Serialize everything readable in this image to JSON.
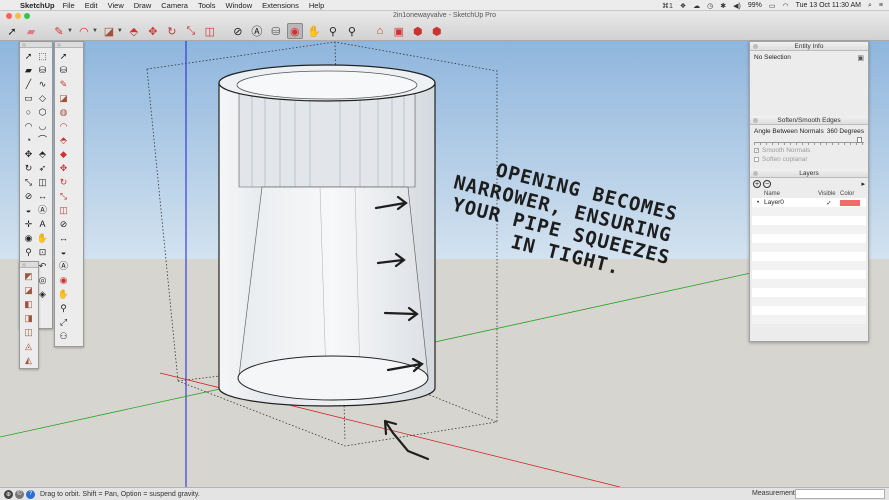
{
  "menubar": {
    "app_name": "SketchUp",
    "items": [
      "File",
      "Edit",
      "View",
      "Draw",
      "Camera",
      "Tools",
      "Window",
      "Extensions",
      "Help"
    ],
    "status_right": {
      "battery": "99%",
      "datetime": "Tue 13 Oct  11:30 AM",
      "input_badge": "1"
    }
  },
  "window": {
    "title": "2in1onewayvalve - SketchUp Pro"
  },
  "toolbar": {
    "tools": [
      "select-arrow-icon",
      "eraser-icon",
      "pencil-line-icon",
      "arc-icon",
      "rectangle-shape-icon",
      "push-pull-icon",
      "move-icon",
      "rotate-icon",
      "scale-icon",
      "offset-icon",
      "tape-measure-icon",
      "text-icon",
      "paint-bucket-icon",
      "orbit-icon",
      "pan-icon",
      "zoom-icon",
      "zoom-extents-icon",
      "warehouse-icon",
      "extension-warehouse-icon",
      "layout-icon",
      "send-icon"
    ],
    "active_tool": "orbit-icon"
  },
  "tray": {
    "entity_info": {
      "title": "Entity Info",
      "selection": "No Selection"
    },
    "soften": {
      "title": "Soften/Smooth Edges",
      "angle_label": "Angle Between Normals",
      "angle_value": "360  Degrees",
      "smooth_normals": "Smooth Normals",
      "soften_coplanar": "Soften coplanar"
    },
    "layers": {
      "title": "Layers",
      "columns": {
        "name": "Name",
        "visible": "Visible",
        "color": "Color"
      },
      "rows": [
        {
          "name": "Layer0",
          "visible": "✓",
          "color": "#f26a6a",
          "active": "•"
        }
      ]
    }
  },
  "annotation": {
    "lines": [
      "OPENING BECOMES",
      "NARROWER, ENSURING",
      "YOUR PIPE SQUEEZES",
      "IN TIGHT."
    ]
  },
  "statusbar": {
    "hint": "Drag to orbit. Shift = Pan, Option = suspend gravity.",
    "measurements_label": "Measurements",
    "measurements_value": ""
  },
  "colors": {
    "sky_top": "#8fb6dd",
    "sky_bottom": "#cfe0ef",
    "ground": "#d6d5cf",
    "layer_color": "#f26a6a",
    "axis_red": "#d02020",
    "axis_green": "#2aa32a",
    "axis_blue": "#2020d0"
  }
}
